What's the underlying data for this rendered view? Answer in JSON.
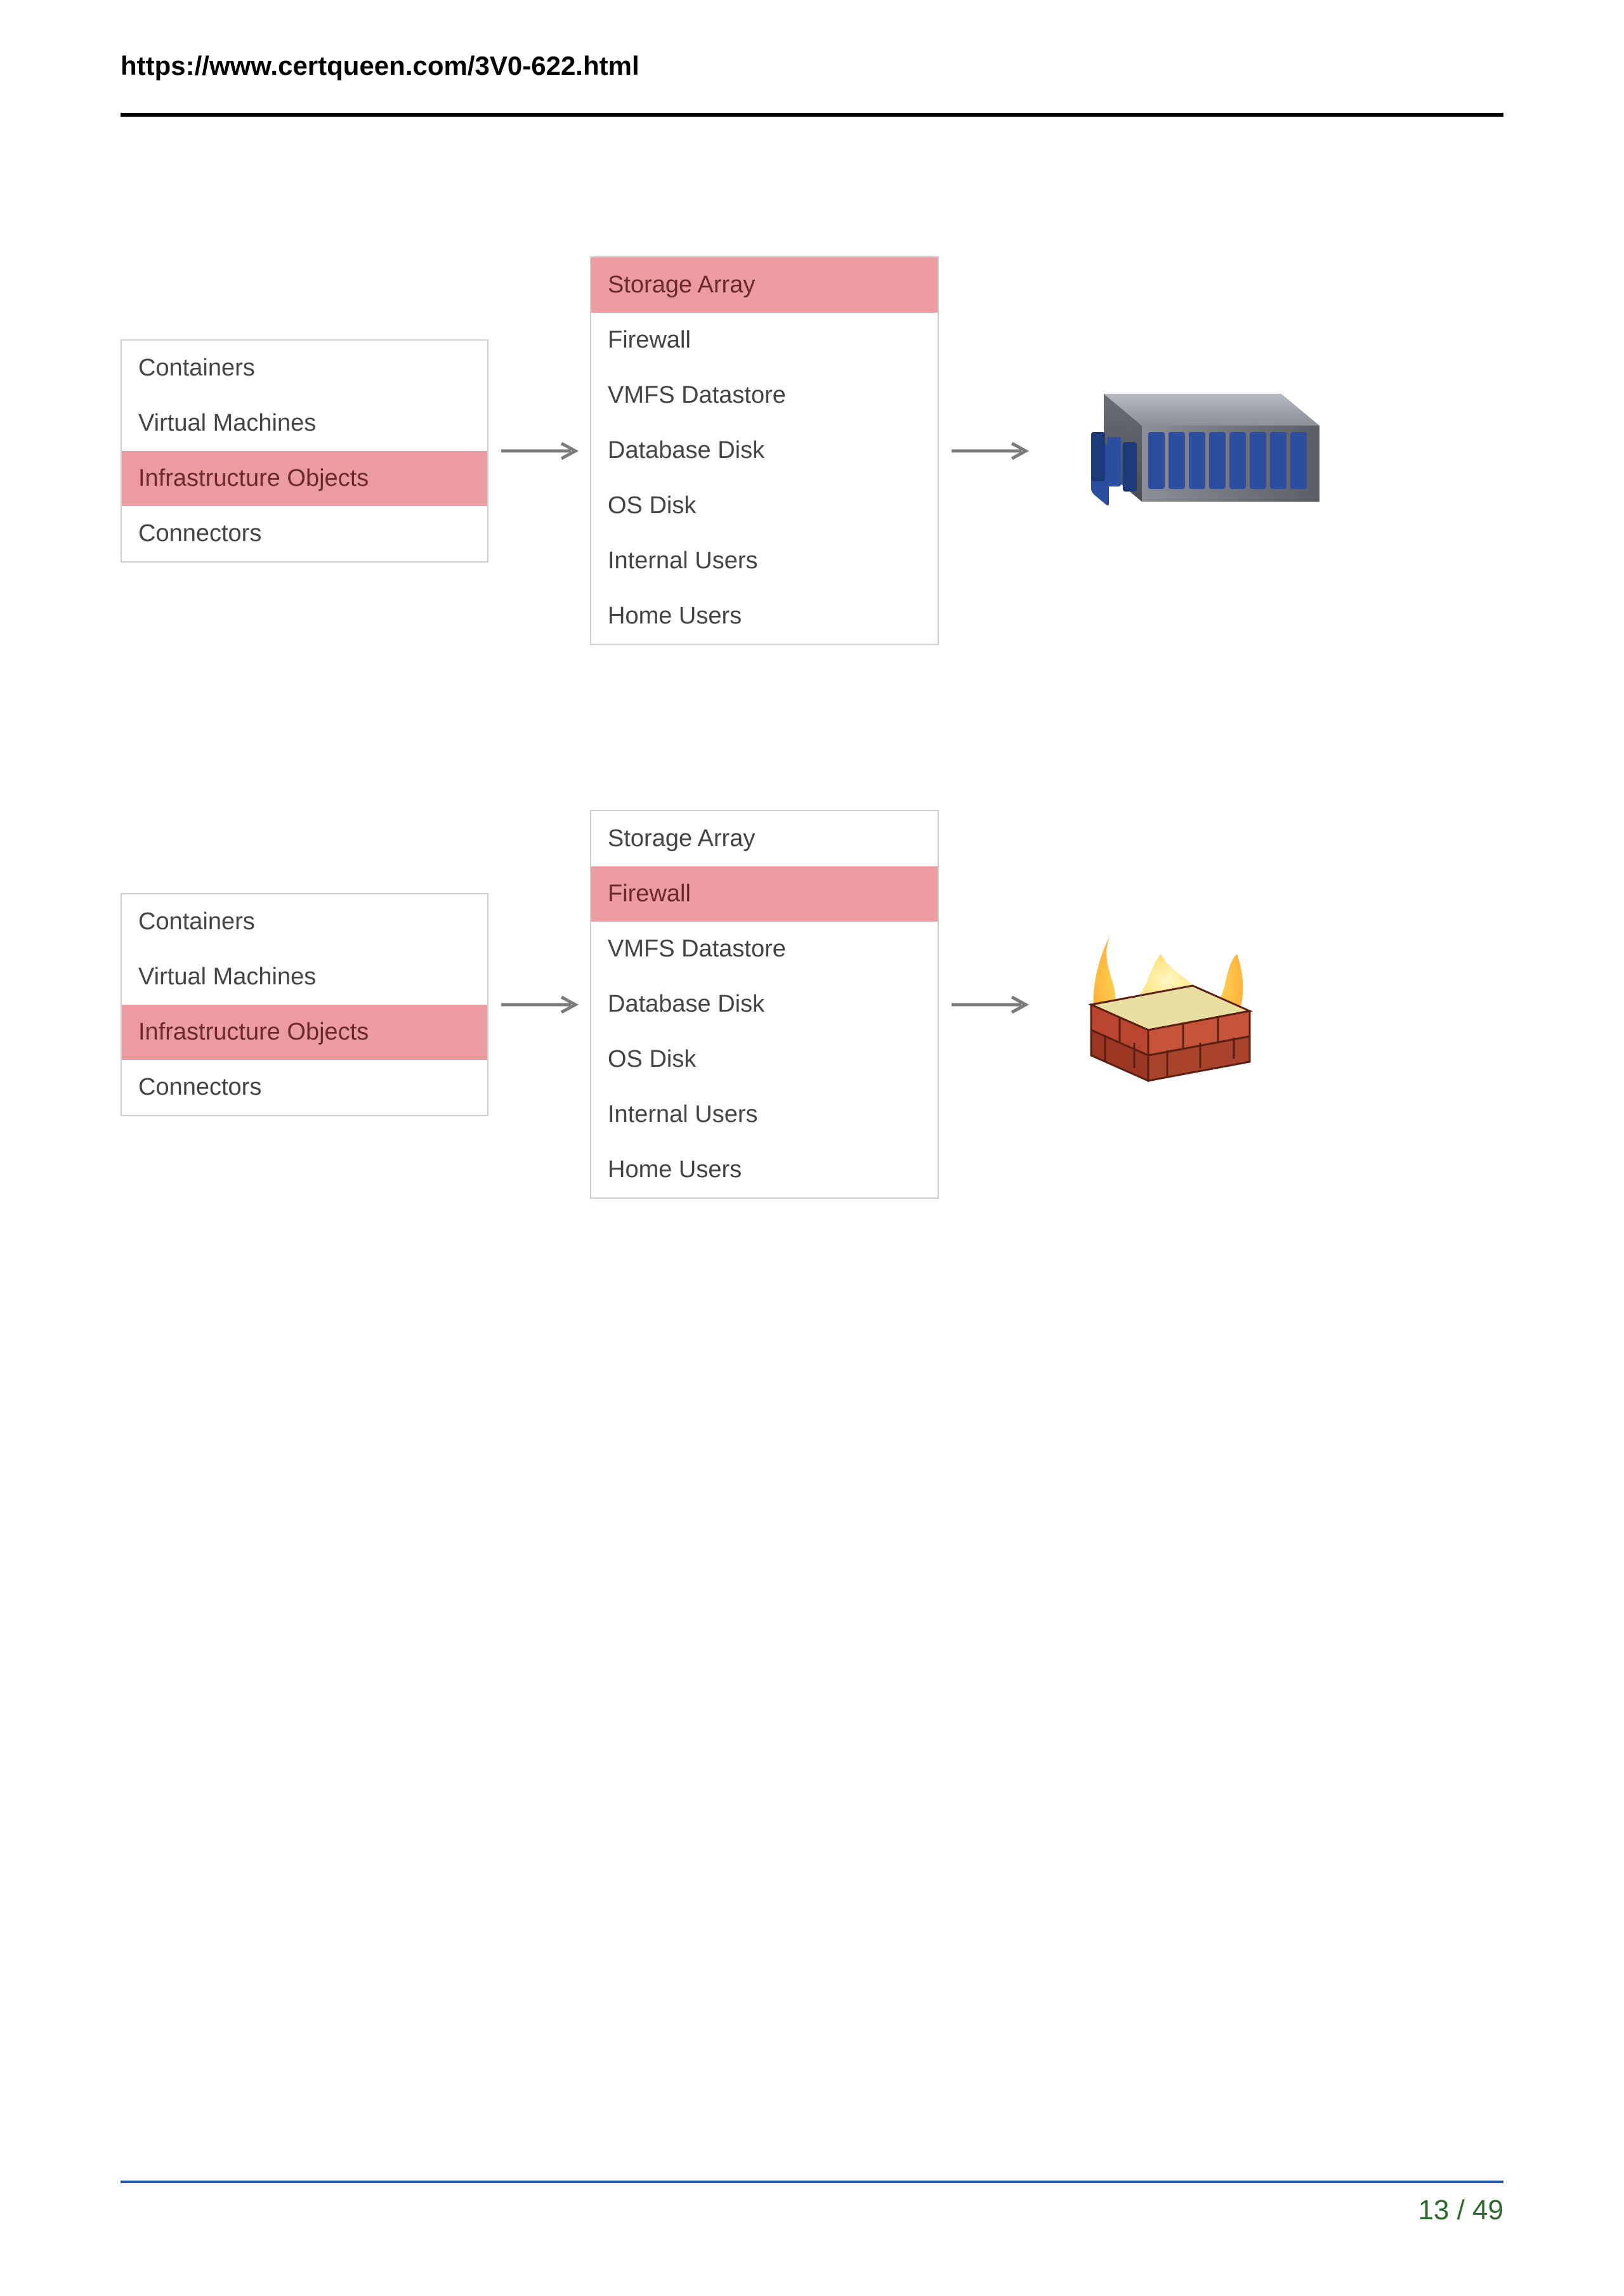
{
  "header": {
    "url": "https://www.certqueen.com/3V0-622.html"
  },
  "diagram1": {
    "left_panel": {
      "items": [
        "Containers",
        "Virtual Machines",
        "Infrastructure Objects",
        "Connectors"
      ],
      "selected_index": 2
    },
    "mid_panel": {
      "items": [
        "Storage Array",
        "Firewall",
        "VMFS Datastore",
        "Database Disk",
        "OS Disk",
        "Internal Users",
        "Home Users"
      ],
      "selected_index": 0
    },
    "icon": "storage-array-icon"
  },
  "diagram2": {
    "left_panel": {
      "items": [
        "Containers",
        "Virtual Machines",
        "Infrastructure Objects",
        "Connectors"
      ],
      "selected_index": 2
    },
    "mid_panel": {
      "items": [
        "Storage Array",
        "Firewall",
        "VMFS Datastore",
        "Database Disk",
        "OS Disk",
        "Internal Users",
        "Home Users"
      ],
      "selected_index": 1
    },
    "icon": "firewall-icon"
  },
  "footer": {
    "page_current": 13,
    "page_total": 49,
    "page_label": "13 / 49"
  }
}
